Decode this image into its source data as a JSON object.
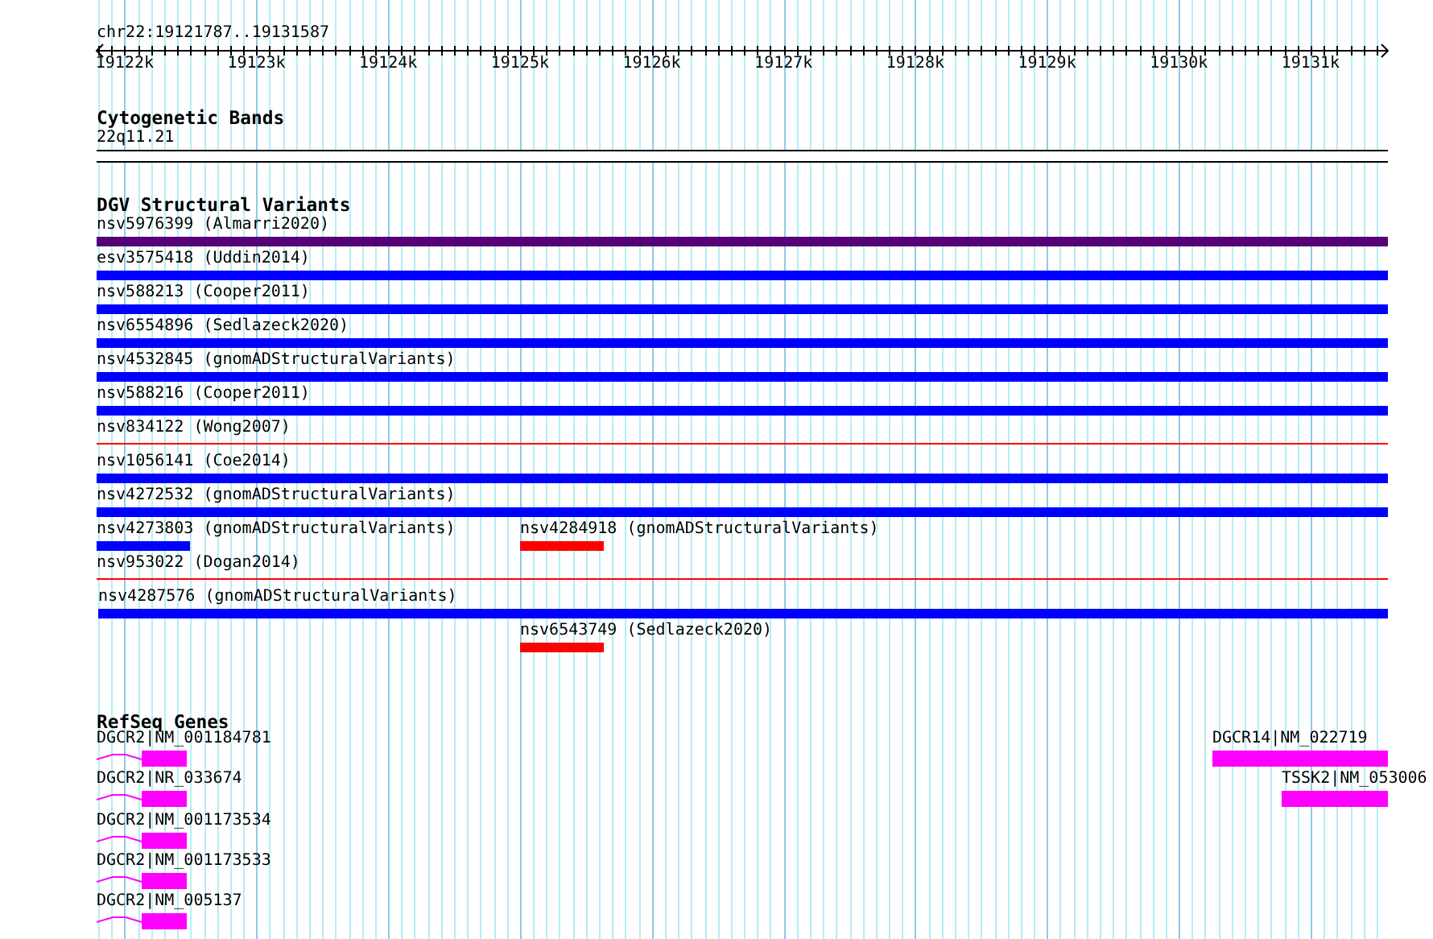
{
  "ruler": {
    "location": "chr22:19121787..19131587",
    "ticks": [
      "19122k",
      "19123k",
      "19124k",
      "19125k",
      "19126k",
      "19127k",
      "19128k",
      "19129k",
      "19130k",
      "19131k"
    ]
  },
  "tracks": [
    {
      "kind": "bands",
      "title": "Cytogenetic Bands",
      "bands": [
        {
          "label": "22q11.21"
        }
      ]
    },
    {
      "kind": "variants",
      "title": "DGV Structural Variants",
      "rows": [
        {
          "features": [
            {
              "label": "nsv5976399 (Almarri2020)",
              "kind": "bar",
              "color": "#550077"
            }
          ]
        },
        {
          "features": [
            {
              "label": "esv3575418 (Uddin2014)",
              "kind": "bar",
              "color": "#0000ff"
            }
          ]
        },
        {
          "features": [
            {
              "label": "nsv588213 (Cooper2011)",
              "kind": "bar",
              "color": "#0000ff"
            }
          ]
        },
        {
          "features": [
            {
              "label": "nsv6554896 (Sedlazeck2020)",
              "kind": "bar",
              "color": "#0000ff"
            }
          ]
        },
        {
          "features": [
            {
              "label": "nsv4532845 (gnomADStructuralVariants)",
              "kind": "bar",
              "color": "#0000ff"
            }
          ]
        },
        {
          "features": [
            {
              "label": "nsv588216 (Cooper2011)",
              "kind": "bar",
              "color": "#0000ff"
            }
          ]
        },
        {
          "features": [
            {
              "label": "nsv834122 (Wong2007)",
              "kind": "line",
              "color": "#ff0000"
            }
          ]
        },
        {
          "features": [
            {
              "label": "nsv1056141 (Coe2014)",
              "kind": "bar",
              "color": "#0000ff"
            }
          ]
        },
        {
          "features": [
            {
              "label": "nsv4272532 (gnomADStructuralVariants)",
              "kind": "bar",
              "color": "#0000ff"
            }
          ]
        },
        {
          "features": [
            {
              "label": "nsv4273803 (gnomADStructuralVariants)",
              "kind": "bar",
              "color": "#0000ff"
            },
            {
              "label": "nsv4284918 (gnomADStructuralVariants)",
              "kind": "bar",
              "color": "#ff0000"
            }
          ]
        },
        {
          "features": [
            {
              "label": "nsv953022 (Dogan2014)",
              "kind": "line",
              "color": "#ff0000"
            }
          ]
        },
        {
          "features": [
            {
              "label": "nsv4287576 (gnomADStructuralVariants)",
              "kind": "bar",
              "color": "#0000ff"
            }
          ]
        },
        {
          "features": [
            {
              "label": "nsv6543749 (Sedlazeck2020)",
              "kind": "bar",
              "color": "#ff0000"
            }
          ]
        }
      ]
    },
    {
      "kind": "genes",
      "title": "RefSeq Genes",
      "rows": [
        {
          "features": [
            {
              "label": "DGCR2|NM_001184781",
              "kind": "spliced"
            },
            {
              "label": "DGCR14|NM_022719",
              "kind": "block"
            }
          ]
        },
        {
          "features": [
            {
              "label": "DGCR2|NR_033674",
              "kind": "spliced"
            },
            {
              "label": "TSSK2|NM_053006",
              "kind": "block"
            }
          ]
        },
        {
          "features": [
            {
              "label": "DGCR2|NM_001173534",
              "kind": "spliced"
            }
          ]
        },
        {
          "features": [
            {
              "label": "DGCR2|NM_001173533",
              "kind": "spliced"
            }
          ]
        },
        {
          "features": [
            {
              "label": "DGCR2|NM_005137",
              "kind": "spliced"
            }
          ]
        }
      ]
    }
  ]
}
